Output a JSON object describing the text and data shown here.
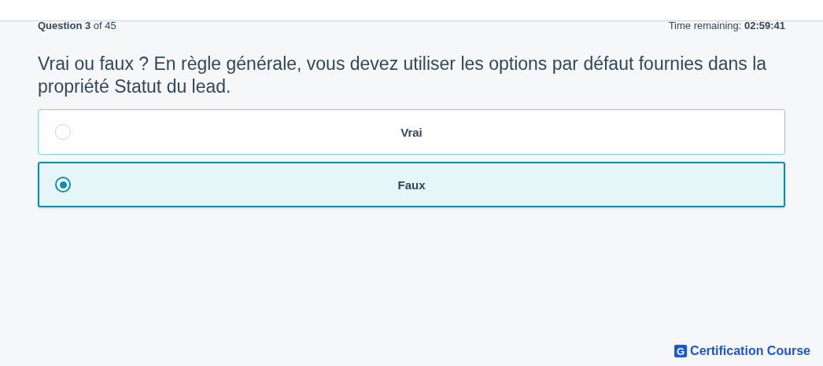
{
  "progress": "**Question 3** of 45",
  "timer": "Time remaining: **02:59:41**",
  "question": "Vrai ou faux ? En règle générale, vous devez utiliser les options par défaut fournies dans la propriété Statut du lead.",
  "options": [
    {
      "label": "Vrai",
      "selected": false
    },
    {
      "label": "Faux",
      "selected": true
    }
  ],
  "brand": {
    "mark": "G",
    "name": "Certification Course"
  }
}
